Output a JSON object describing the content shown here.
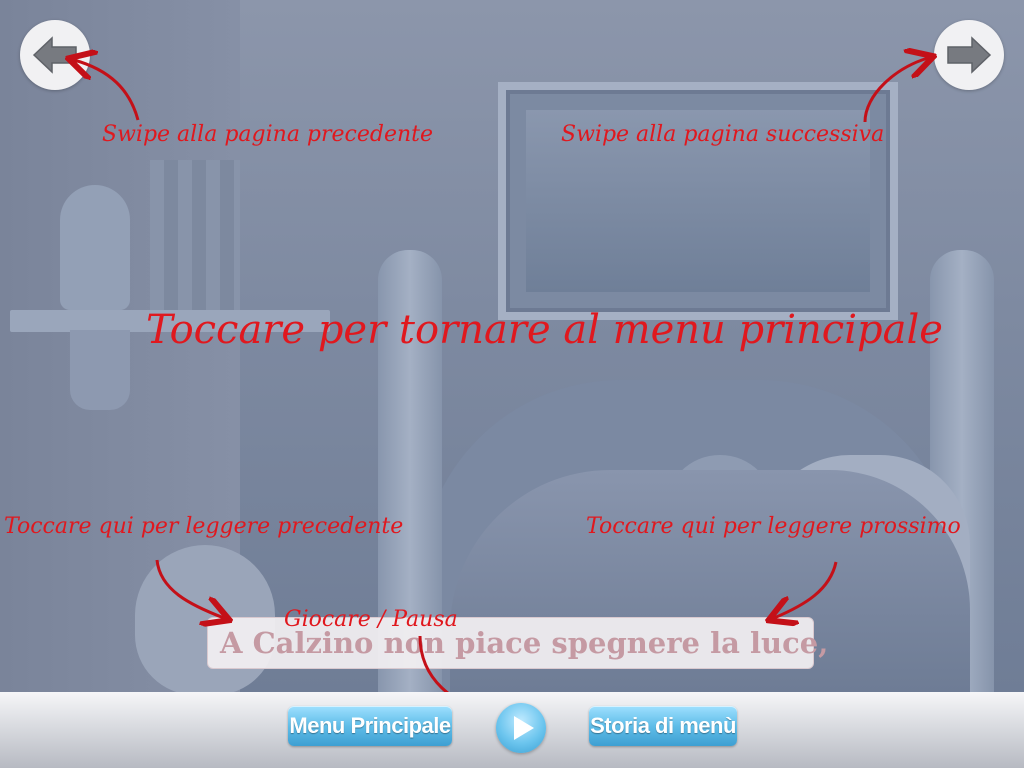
{
  "help": {
    "swipe_prev": "Swipe alla pagina precedente",
    "swipe_next": "Swipe alla pagina successiva",
    "tap_menu": "Toccare per tornare al menu principale",
    "tap_prev": "Toccare qui per leggere precedente",
    "tap_next": "Toccare qui per leggere prossimo",
    "play_pause": "Giocare / Pausa"
  },
  "story": {
    "line": "A Calzino non piace spegnere la luce,"
  },
  "toolbar": {
    "main_menu": "Menu Principale",
    "story_menu": "Storia di menù"
  },
  "icons": {
    "prev": "arrow-left-icon",
    "next": "arrow-right-icon",
    "play": "play-icon"
  },
  "colors": {
    "help_text": "#e0181e",
    "button_blue": "#5fbde8"
  }
}
